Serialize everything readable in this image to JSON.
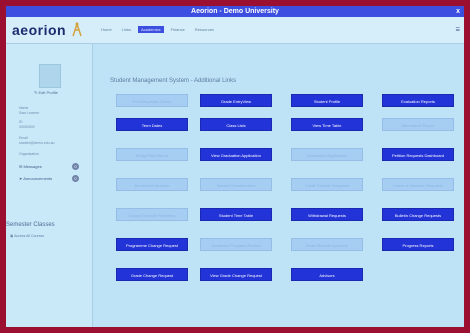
{
  "window": {
    "title": "Aeorion - Demo University",
    "close_glyph": "x"
  },
  "app": {
    "logo_text": "aeorion"
  },
  "nav": {
    "items": [
      "Home",
      "Links",
      "Academics",
      "Finance",
      "Resources"
    ]
  },
  "profile": {
    "edit_label": "Edit Profile",
    "fields": [
      {
        "label": "Name",
        "value": "Sam Learner"
      },
      {
        "label": "ID",
        "value": "00000000"
      },
      {
        "label": "Email",
        "value": "student@demo.edu.au"
      },
      {
        "label": "Organisation",
        "value": ""
      }
    ]
  },
  "sidebar": {
    "messages": {
      "label": "Messages",
      "count": "0"
    },
    "announcements": {
      "label": "Announcements",
      "count": "0"
    },
    "semester_heading": "Semester Classes",
    "all_courses": "Access All Courses"
  },
  "main": {
    "title": "Student Management System - Additional Links",
    "buttons": [
      {
        "label": "Pre-Requisites Check",
        "active": false
      },
      {
        "label": "Grade EntryView",
        "active": true
      },
      {
        "label": "Student Profile",
        "active": true
      },
      {
        "label": "Evaluation Reports",
        "active": true
      },
      {
        "label": "Term Dates",
        "active": true
      },
      {
        "label": "Class Lists",
        "active": true
      },
      {
        "label": "View Time Table",
        "active": true
      },
      {
        "label": "Attendance Report",
        "active": false
      },
      {
        "label": "Study Plan Report",
        "active": false
      },
      {
        "label": "View Graduation Application",
        "active": true
      },
      {
        "label": "Graduation Application",
        "active": false
      },
      {
        "label": "Petition Requests Dashboard",
        "active": true
      },
      {
        "label": "Enrolment Variation",
        "active": false
      },
      {
        "label": "Special Consideration",
        "active": false
      },
      {
        "label": "Credit Transfer Requests",
        "active": false
      },
      {
        "label": "Leave of Absence Requests",
        "active": false
      },
      {
        "label": "Course Transfer Requests",
        "active": false
      },
      {
        "label": "Student Time Table",
        "active": true
      },
      {
        "label": "Withdrawal Requests",
        "active": true
      },
      {
        "label": "Bulletin Change Requests",
        "active": true
      },
      {
        "label": "Programme Change Request",
        "active": true
      },
      {
        "label": "Academic Progress Review",
        "active": false
      },
      {
        "label": "Exam Results Approval",
        "active": false
      },
      {
        "label": "Progress Reports",
        "active": true
      },
      {
        "label": "Grade Change Request",
        "active": true
      },
      {
        "label": "View Grade Change Request",
        "active": true
      },
      {
        "label": "Advisors",
        "active": true
      }
    ]
  },
  "colors": {
    "active_button": "#2233d8",
    "inactive_button": "#a6cdf2",
    "title_bar": "#3d4fe0",
    "frame": "#9b1030"
  }
}
